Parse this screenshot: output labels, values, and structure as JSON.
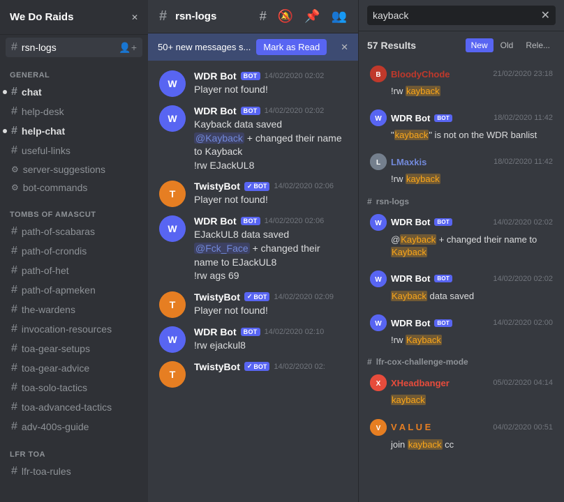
{
  "server": {
    "name": "We Do Raids",
    "chevron": "▾"
  },
  "sidebar": {
    "active_channel": "rsn-logs",
    "sections": [
      {
        "label": "",
        "items": [
          {
            "id": "rsn-logs",
            "name": "rsn-logs",
            "type": "text",
            "active": true,
            "unread": false
          }
        ]
      },
      {
        "label": "GENERAL",
        "items": [
          {
            "id": "chat",
            "name": "chat",
            "type": "text",
            "active": false,
            "unread": true
          },
          {
            "id": "help-desk",
            "name": "help-desk",
            "type": "text",
            "active": false,
            "unread": false
          },
          {
            "id": "help-chat",
            "name": "help-chat",
            "type": "text",
            "active": false,
            "unread": true
          },
          {
            "id": "useful-links",
            "name": "useful-links",
            "type": "text",
            "active": false,
            "unread": false
          },
          {
            "id": "server-suggestions",
            "name": "server-suggestions",
            "type": "text",
            "active": false,
            "unread": false
          },
          {
            "id": "bot-commands",
            "name": "bot-commands",
            "type": "text",
            "active": false,
            "unread": false
          }
        ]
      },
      {
        "label": "TOMBS OF AMASCUT",
        "items": [
          {
            "id": "path-of-scabaras",
            "name": "path-of-scabaras",
            "type": "text",
            "active": false,
            "unread": false
          },
          {
            "id": "path-of-crondis",
            "name": "path-of-crondis",
            "type": "text",
            "active": false,
            "unread": false
          },
          {
            "id": "path-of-het",
            "name": "path-of-het",
            "type": "text",
            "active": false,
            "unread": false
          },
          {
            "id": "path-of-apmeken",
            "name": "path-of-apmeken",
            "type": "text",
            "active": false,
            "unread": false
          },
          {
            "id": "the-wardens",
            "name": "the-wardens",
            "type": "text",
            "active": false,
            "unread": false
          },
          {
            "id": "invocation-resources",
            "name": "invocation-resources",
            "type": "text",
            "active": false,
            "unread": false
          },
          {
            "id": "toa-gear-setups",
            "name": "toa-gear-setups",
            "type": "text",
            "active": false,
            "unread": false
          },
          {
            "id": "toa-gear-advice",
            "name": "toa-gear-advice",
            "type": "text",
            "active": false,
            "unread": false
          },
          {
            "id": "toa-solo-tactics",
            "name": "toa-solo-tactics",
            "type": "text",
            "active": false,
            "unread": false
          },
          {
            "id": "toa-advanced-tactics",
            "name": "toa-advanced-tactics",
            "type": "text",
            "active": false,
            "unread": false
          },
          {
            "id": "adv-400s-guide",
            "name": "adv-400s-guide",
            "type": "text",
            "active": false,
            "unread": false
          }
        ]
      },
      {
        "label": "LFR TOA",
        "items": [
          {
            "id": "lfr-toa-rules",
            "name": "lfr-toa-rules",
            "type": "text",
            "active": false,
            "unread": false
          }
        ]
      }
    ]
  },
  "channel": {
    "name": "rsn-logs",
    "new_messages_text": "50+ new messages s...",
    "mark_as_read": "Mark as Read"
  },
  "messages": [
    {
      "id": "m1",
      "author": "WDR Bot",
      "is_bot": true,
      "verified": false,
      "timestamp": "14/02/2020 02:02",
      "text": "Player not found!",
      "avatar_color": "wdr",
      "avatar_text": "W"
    },
    {
      "id": "m2",
      "author": "WDR Bot",
      "is_bot": true,
      "verified": false,
      "timestamp": "14/02/2020 02:02",
      "text": "@Kayback + changed their name to Kayback\n!rw EJackUL8",
      "mention": "@Kayback",
      "avatar_color": "wdr",
      "avatar_text": "W"
    },
    {
      "id": "m3",
      "author": "TwistyBot",
      "is_bot": true,
      "verified": true,
      "timestamp": "14/02/2020 02:06",
      "text": "Player not found!",
      "avatar_color": "twisty",
      "avatar_text": "T"
    },
    {
      "id": "m4",
      "author": "WDR Bot",
      "is_bot": true,
      "verified": false,
      "timestamp": "14/02/2020 02:06",
      "text": "EJackUL8 data saved\n@Fck_Face + changed their name to EJackUL8\n!rw ags 69",
      "avatar_color": "wdr",
      "avatar_text": "W"
    },
    {
      "id": "m5",
      "author": "TwistyBot",
      "is_bot": true,
      "verified": true,
      "timestamp": "14/02/2020 02:09",
      "text": "Player not found!",
      "avatar_color": "twisty",
      "avatar_text": "T"
    },
    {
      "id": "m6",
      "author": "WDR Bot",
      "is_bot": true,
      "verified": false,
      "timestamp": "14/02/2020 02:10",
      "text": "!rw ejackul8",
      "avatar_color": "wdr",
      "avatar_text": "W"
    },
    {
      "id": "m7",
      "author": "TwistyBot",
      "is_bot": true,
      "verified": true,
      "timestamp": "14/02/2020 02:",
      "text": "",
      "avatar_color": "twisty",
      "avatar_text": "T"
    }
  ],
  "search": {
    "query": "kayback",
    "placeholder": "kayback",
    "results_count": "57 Results",
    "filters": [
      "New",
      "Old",
      "Rele..."
    ]
  },
  "search_results": [
    {
      "id": "sr1",
      "channel": null,
      "author": "BloodyChode",
      "author_color": "#c0392b",
      "timestamp": "21/02/2020 23:18",
      "text": "!rw kayback",
      "highlight": "kayback",
      "avatar_color": "av-bloody",
      "avatar_text": "B"
    },
    {
      "id": "sr2",
      "channel": null,
      "author": "WDR Bot",
      "author_color": "#ffffff",
      "is_bot": true,
      "timestamp": "18/02/2020 11:42",
      "text": "\"kayback\" is not on the WDR banlist",
      "highlight": "kayback",
      "avatar_color": "av-wdr",
      "avatar_text": "W"
    },
    {
      "id": "sr3",
      "channel": null,
      "author": "LMaxkis",
      "author_color": "#7289da",
      "timestamp": "18/02/2020 11:42",
      "text": "!rw kayback",
      "highlight": "kayback",
      "avatar_color": "av-lm",
      "avatar_text": "L"
    }
  ],
  "search_sections": [
    {
      "id": "ss1",
      "channel_name": "rsn-logs",
      "results": [
        {
          "id": "ss1r1",
          "author": "WDR Bot",
          "author_color": "#ffffff",
          "is_bot": true,
          "timestamp": "14/02/2020 02:02",
          "text": "@Kayback + changed their name to Kayback",
          "highlight": "Kayback",
          "avatar_color": "av-wdr",
          "avatar_text": "W"
        },
        {
          "id": "ss1r2",
          "author": "WDR Bot",
          "author_color": "#ffffff",
          "is_bot": true,
          "timestamp": "14/02/2020 02:02",
          "text": "Kayback data saved",
          "highlight": "Kayback",
          "avatar_color": "av-wdr",
          "avatar_text": "W"
        },
        {
          "id": "ss1r3",
          "author": "WDR Bot",
          "author_color": "#ffffff",
          "is_bot": true,
          "timestamp": "14/02/2020 02:00",
          "text": "!rw Kayback",
          "highlight": "Kayback",
          "avatar_color": "av-wdr",
          "avatar_text": "W"
        }
      ]
    },
    {
      "id": "ss2",
      "channel_name": "lfr-cox-challenge-mode",
      "results": [
        {
          "id": "ss2r1",
          "author": "XHeadbanger",
          "author_color": "#e74c3c",
          "is_bot": false,
          "timestamp": "05/02/2020 04:14",
          "text": "kayback",
          "highlight": "kayback",
          "avatar_color": "av-xhead",
          "avatar_text": "X"
        },
        {
          "id": "ss2r2",
          "author": "V A L U E",
          "author_color": "#e67e22",
          "is_bot": false,
          "timestamp": "04/02/2020 00:51",
          "text": "join kayback cc",
          "highlight": "kayback",
          "avatar_color": "av-value",
          "avatar_text": "V"
        }
      ]
    }
  ]
}
